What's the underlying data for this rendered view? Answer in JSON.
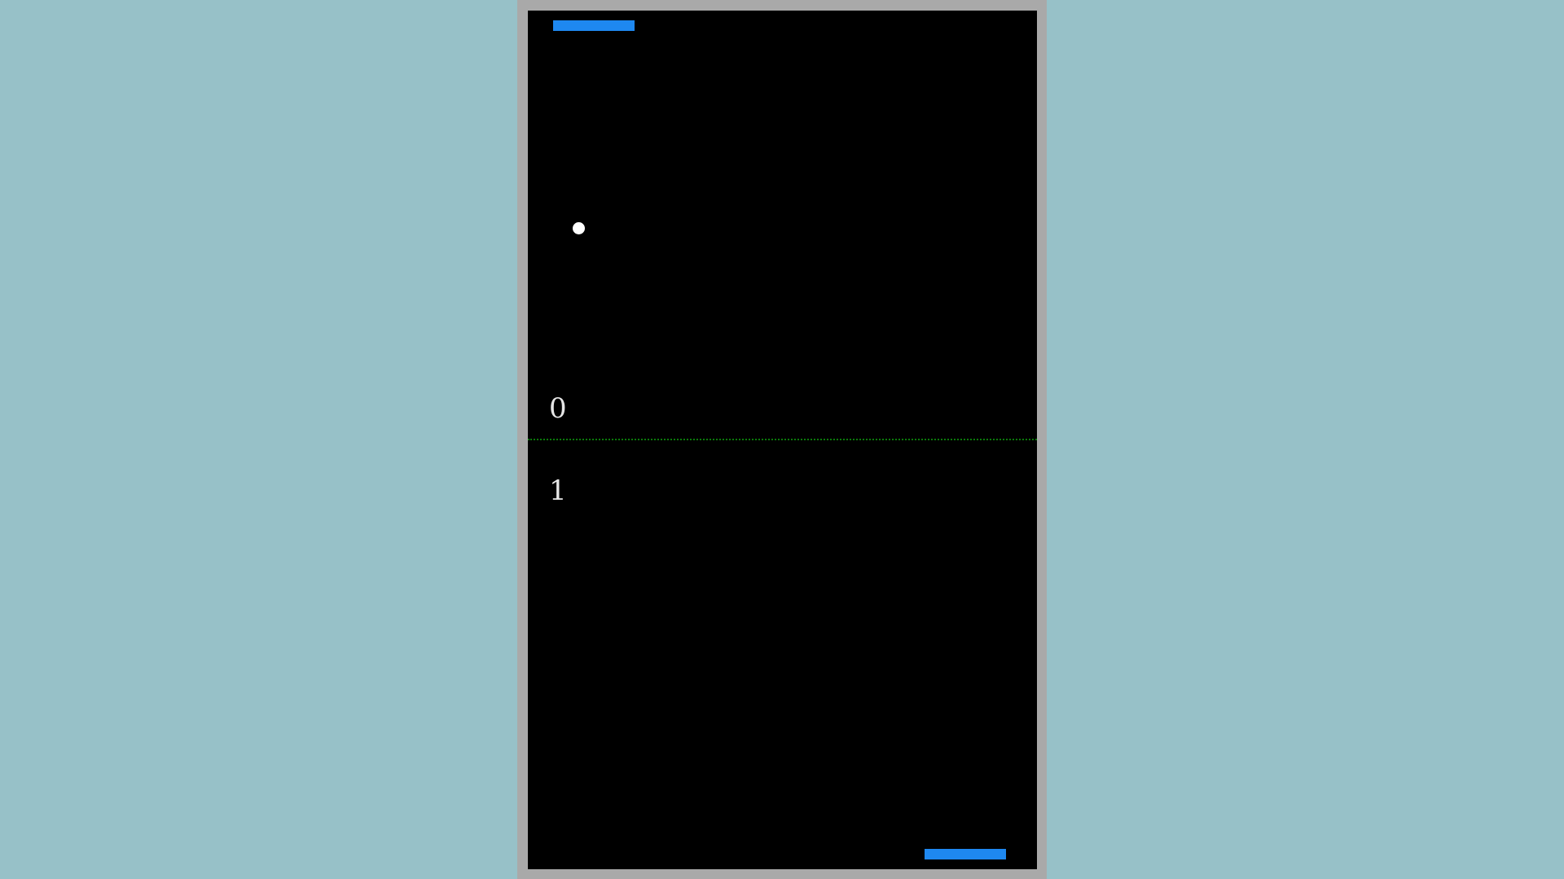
{
  "game": {
    "title": "",
    "scores": {
      "top_player": "0",
      "bottom_player": "1"
    }
  },
  "colors": {
    "page_background": "#97c1c8",
    "frame": "#a9a9a9",
    "court": "#000000",
    "paddle": "#1e88f0",
    "ball": "#ffffff",
    "midline": "#0a7a0a",
    "score_text": "#e6e6e6"
  }
}
